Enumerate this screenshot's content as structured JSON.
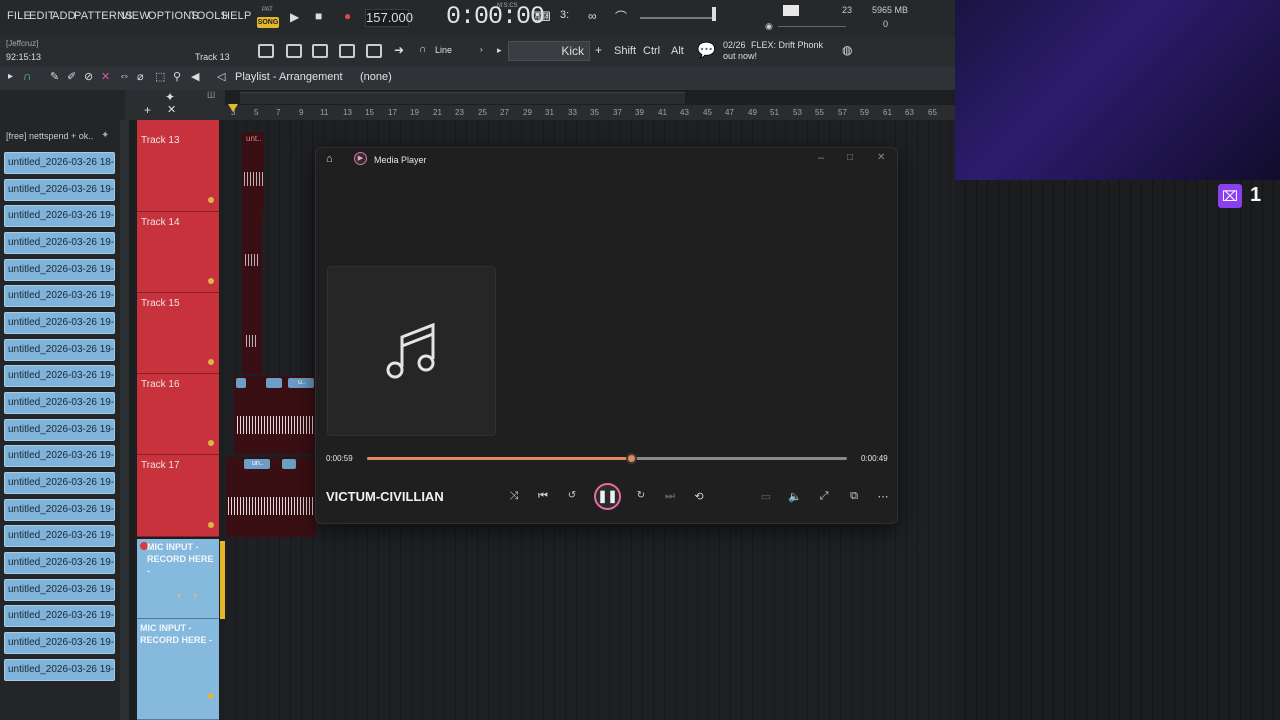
{
  "menu": {
    "items": [
      "FILE",
      "EDIT",
      "ADD",
      "PATTERNS",
      "VIEW",
      "OPTIONS",
      "TOOLS",
      "HELP"
    ]
  },
  "transport": {
    "pat": "PAT",
    "song": "SONG",
    "tempo": "157.000",
    "time": "0:00:00",
    "time_sub": "M:S:CS"
  },
  "stats": {
    "cpu": "23",
    "memory": "5965 MB",
    "poly": "0"
  },
  "user": {
    "name": "[Jeffcruz]",
    "clock": "92:15:13"
  },
  "toolbar": {
    "track_label": "Track 13",
    "snap": "Line",
    "pattern": "Kick",
    "mod_shift": "Shift",
    "mod_ctrl": "Ctrl",
    "mod_alt": "Alt",
    "hint_date": "02/26",
    "hint_text": "FLEX: Drift Phonk out now!"
  },
  "playlist": {
    "title": "Playlist - Arrangement",
    "pattern": "(none)"
  },
  "ruler": [
    "3",
    "5",
    "7",
    "9",
    "11",
    "13",
    "15",
    "17",
    "19",
    "21",
    "23",
    "25",
    "27",
    "29",
    "31",
    "33",
    "35",
    "37",
    "39",
    "41",
    "43",
    "45",
    "47",
    "49",
    "51",
    "53",
    "55",
    "57",
    "59",
    "61",
    "63",
    "65"
  ],
  "browser": {
    "folder": "[free] nettspend + ok..",
    "items": [
      "untitled_2026-03-26 18-...",
      "untitled_2026-03-26 19-...",
      "untitled_2026-03-26 19-...",
      "untitled_2026-03-26 19-...",
      "untitled_2026-03-26 19-...",
      "untitled_2026-03-26 19-...",
      "untitled_2026-03-26 19-...",
      "untitled_2026-03-26 19-...",
      "untitled_2026-03-26 19-...",
      "untitled_2026-03-26 19-...",
      "untitled_2026-03-26 19-...",
      "untitled_2026-03-26 19-...",
      "untitled_2026-03-26 19-...",
      "untitled_2026-03-26 19-...",
      "untitled_2026-03-26 19-...",
      "untitled_2026-03-26 19-...",
      "untitled_2026-03-26 19-...",
      "untitled_2026-03-26 19-...",
      "untitled_2026-03-26 19-...",
      "untitled_2026-03-26 19-..."
    ]
  },
  "tracks": [
    "Track 13",
    "Track 14",
    "Track 15",
    "Track 16",
    "Track 17"
  ],
  "mic_label": "MIC INPUT - RECORD HERE -",
  "clips": {
    "c13": "unt..",
    "c16": "u..",
    "c17": "un.."
  },
  "media_player": {
    "title": "Media Player",
    "song": "VICTUM-CIVILLIAN",
    "elapsed": "0:00:59",
    "remaining": "0:00:49",
    "progress": 0.55
  },
  "twitch": {
    "count": "1"
  },
  "colors": {
    "track": "#c7323c",
    "clip": "#7fb3d9",
    "accent": "#e38a5c",
    "pause_ring": "#e56fa2"
  }
}
